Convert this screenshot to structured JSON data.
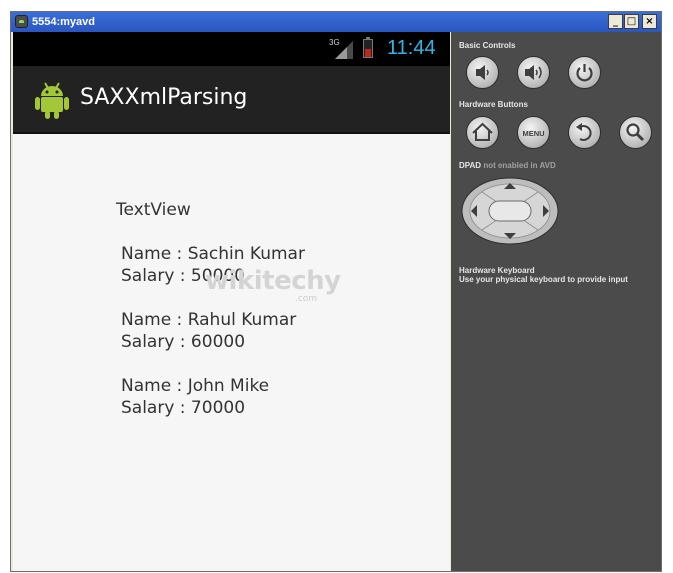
{
  "window": {
    "title": "5554:myavd",
    "minimize_label": "_",
    "maximize_label": "□",
    "close_label": "×"
  },
  "device": {
    "status_bar": {
      "network_type": "3G",
      "time": "11:44",
      "battery_color": "#c32420",
      "clock_color": "#33b5e5"
    },
    "action_bar": {
      "app_title": "SAXXmlParsing",
      "app_icon": "android-robot-icon"
    },
    "content": {
      "textview_label": "TextView",
      "records": [
        {
          "name_line": "Name : Sachin Kumar",
          "salary_line": "Salary : 50000"
        },
        {
          "name_line": "Name : Rahul Kumar",
          "salary_line": "Salary : 60000"
        },
        {
          "name_line": "Name : John Mike",
          "salary_line": "Salary : 70000"
        }
      ],
      "watermark": {
        "main": "wikitechy",
        "sub": ".com"
      }
    }
  },
  "controls": {
    "basic_controls_label": "Basic Controls",
    "hardware_buttons_label": "Hardware Buttons",
    "dpad_label": "DPAD",
    "dpad_note": "not enabled in AVD",
    "keyboard_title": "Hardware Keyboard",
    "keyboard_hint": "Use your physical keyboard to provide input",
    "menu_label": "MENU",
    "basic_buttons": [
      "volume-down-icon",
      "volume-up-icon",
      "power-icon"
    ],
    "hardware_buttons": [
      "home-icon",
      "menu-button",
      "back-icon",
      "search-icon"
    ]
  }
}
